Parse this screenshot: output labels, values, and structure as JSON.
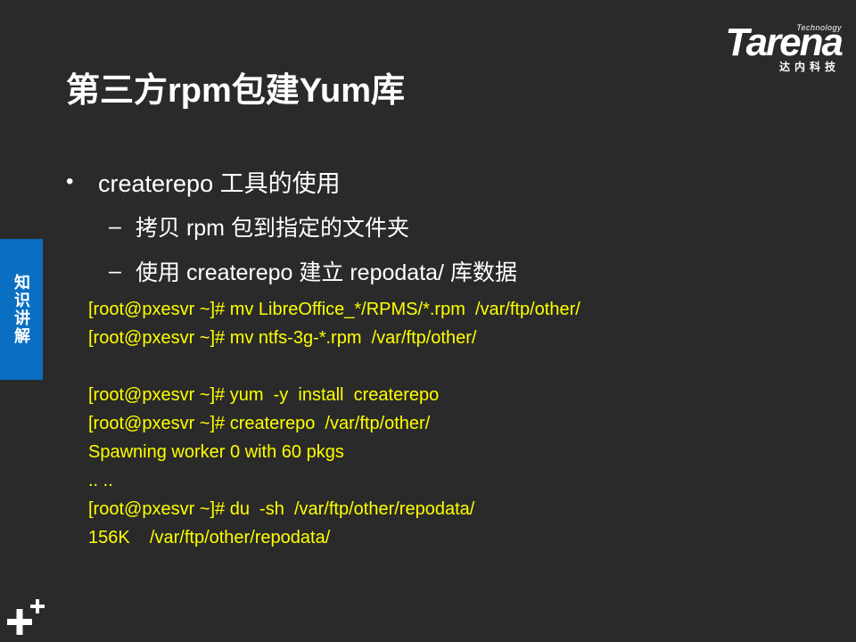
{
  "slide": {
    "title": "第三方rpm包建Yum库",
    "logo": {
      "technology": "Technology",
      "brand": "Tarena",
      "subtitle": "达内科技"
    },
    "side_tab": "知识讲解",
    "bullet": {
      "dot": "•",
      "text": "createrepo 工具的使用"
    },
    "sub_bullets": [
      {
        "dash": "–",
        "text": "拷贝 rpm 包到指定的文件夹"
      },
      {
        "dash": "–",
        "text": "使用 createrepo 建立 repodata/ 库数据"
      }
    ],
    "code_lines": [
      "[root@pxesvr ~]# mv LibreOffice_*/RPMS/*.rpm  /var/ftp/other/",
      "[root@pxesvr ~]# mv ntfs-3g-*.rpm  /var/ftp/other/",
      "",
      "[root@pxesvr ~]# yum  -y  install  createrepo",
      "[root@pxesvr ~]# createrepo  /var/ftp/other/",
      "Spawning worker 0 with 60 pkgs",
      ".. ..",
      "[root@pxesvr ~]# du  -sh  /var/ftp/other/repodata/",
      "156K    /var/ftp/other/repodata/"
    ],
    "colors": {
      "background": "#2a2a2a",
      "code_text": "#ffff00",
      "side_tab": "#0a6fc2",
      "text": "#ffffff"
    },
    "icons": {
      "corner": "plus-plus-icon"
    }
  }
}
